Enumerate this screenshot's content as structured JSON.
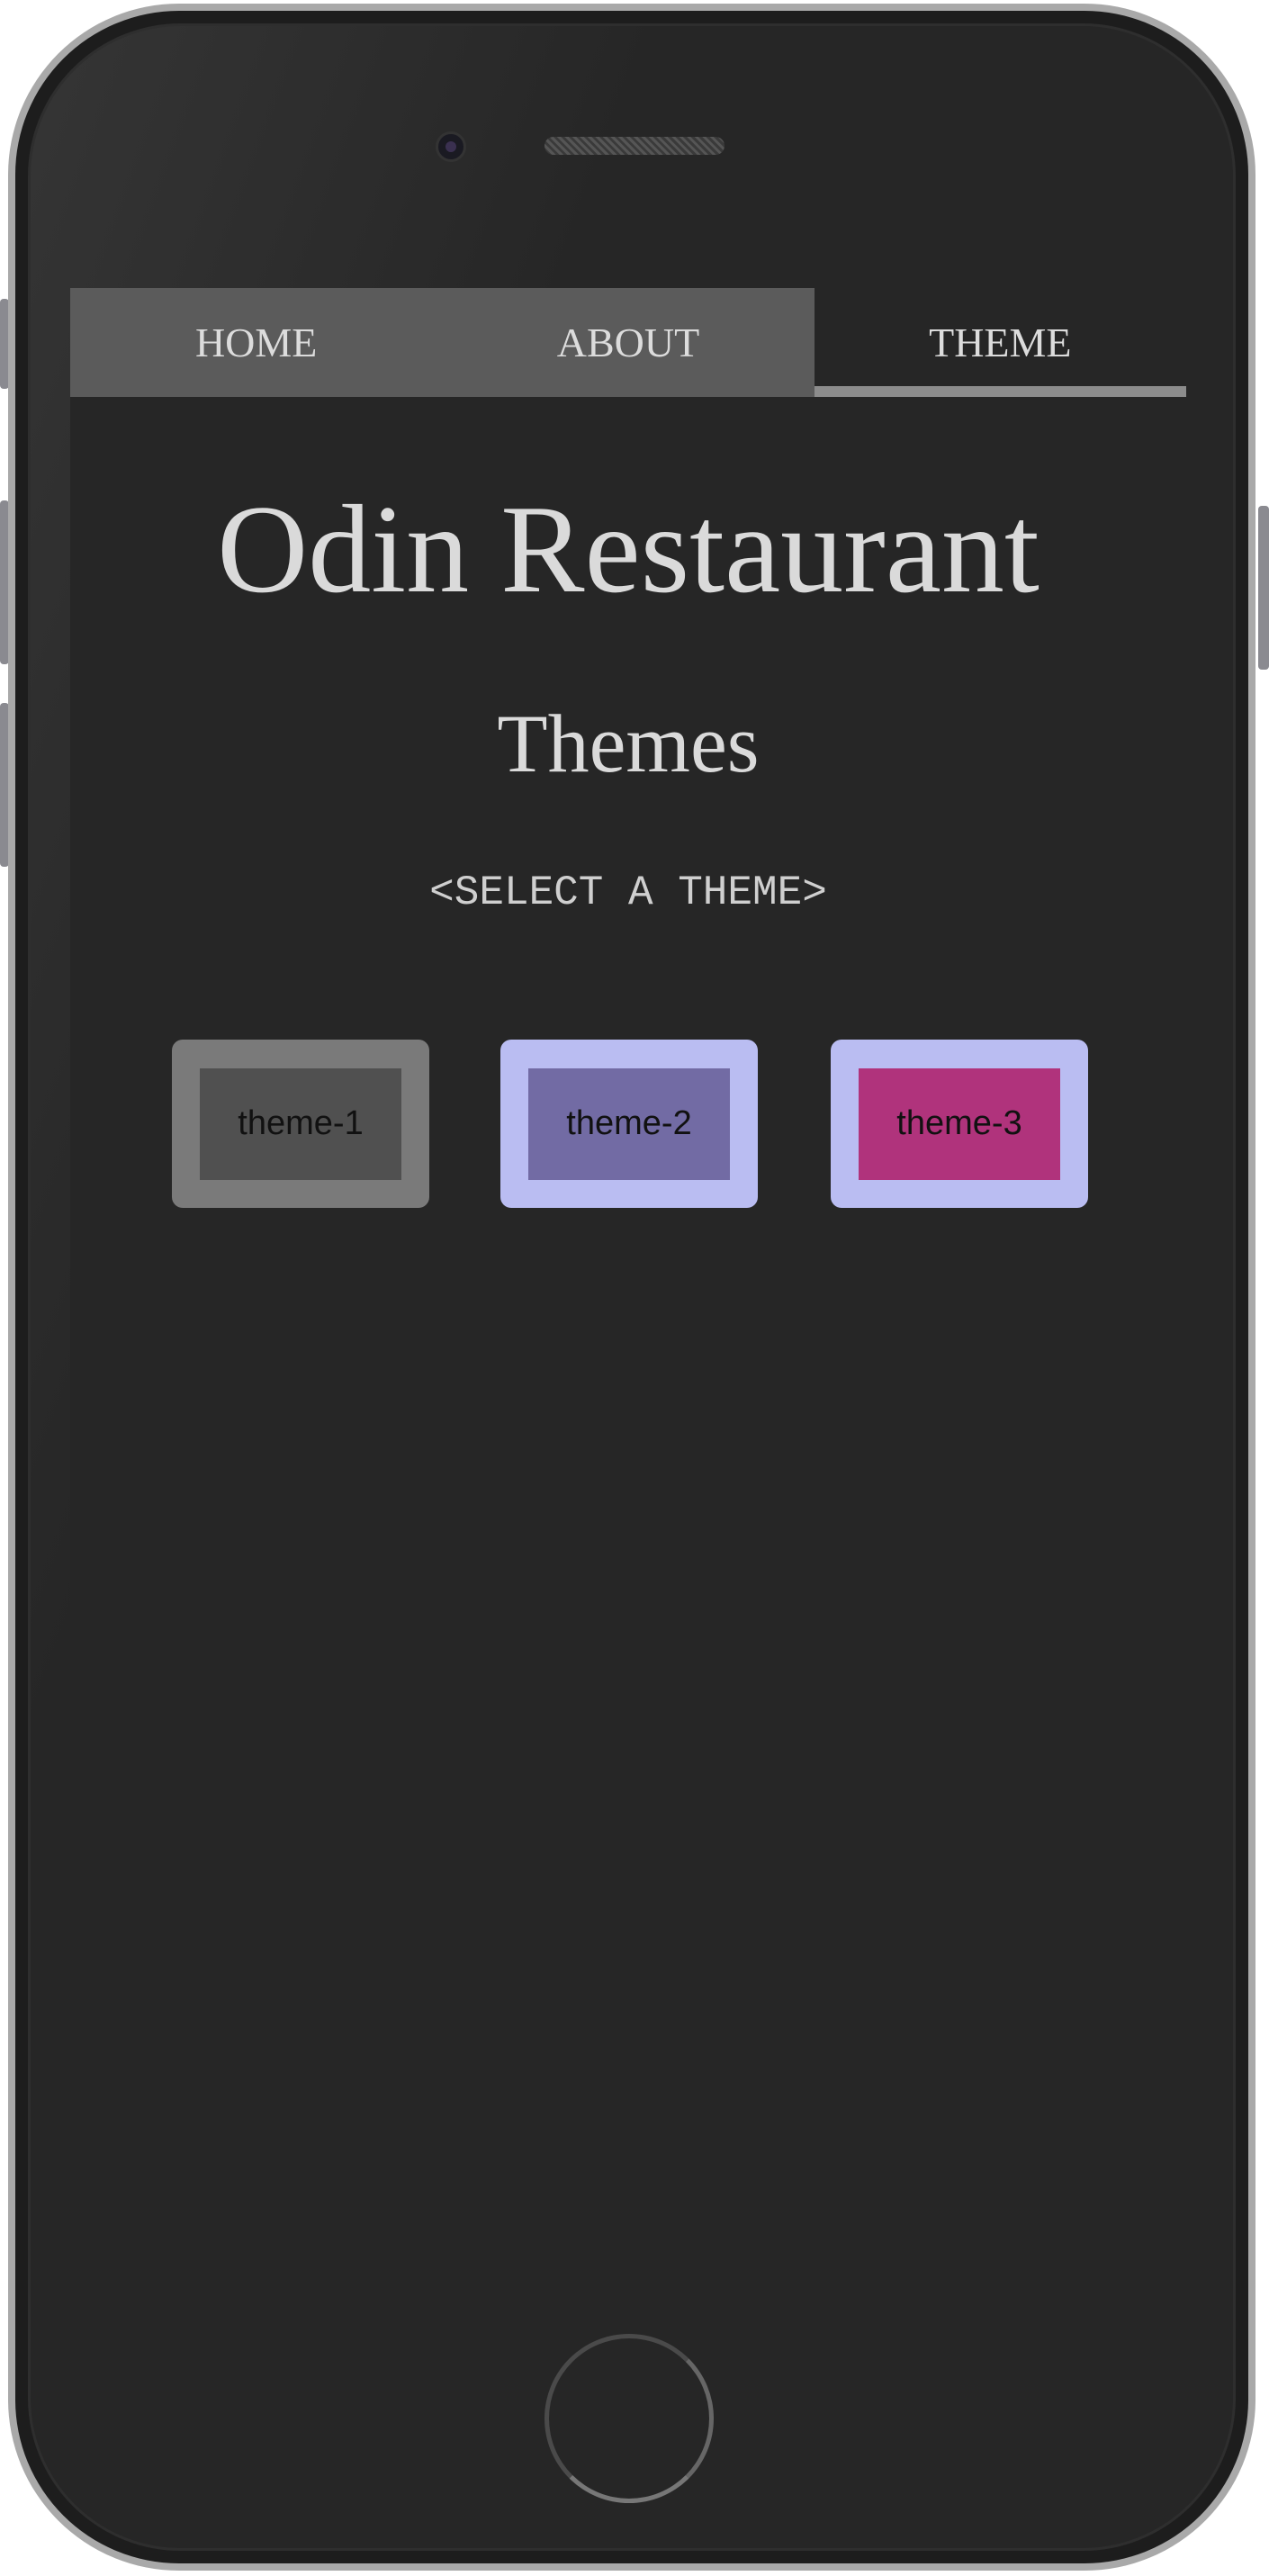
{
  "nav": {
    "items": [
      {
        "label": "HOME",
        "active": false
      },
      {
        "label": "ABOUT",
        "active": false
      },
      {
        "label": "THEME",
        "active": true
      }
    ]
  },
  "main": {
    "title": "Odin Restaurant",
    "subtitle": "Themes",
    "prompt": "<SELECT A THEME>",
    "themes": [
      {
        "label": "theme-1",
        "frame_color": "#7a7a7a",
        "fill_color": "#505050"
      },
      {
        "label": "theme-2",
        "frame_color": "#babdf2",
        "fill_color": "#726ba4"
      },
      {
        "label": "theme-3",
        "frame_color": "#babdf2",
        "fill_color": "#b0337c"
      }
    ]
  },
  "colors": {
    "background": "#262626",
    "nav_bg": "#5b5b5b",
    "nav_active_underline": "#8c8c8c",
    "text": "#dadada"
  }
}
